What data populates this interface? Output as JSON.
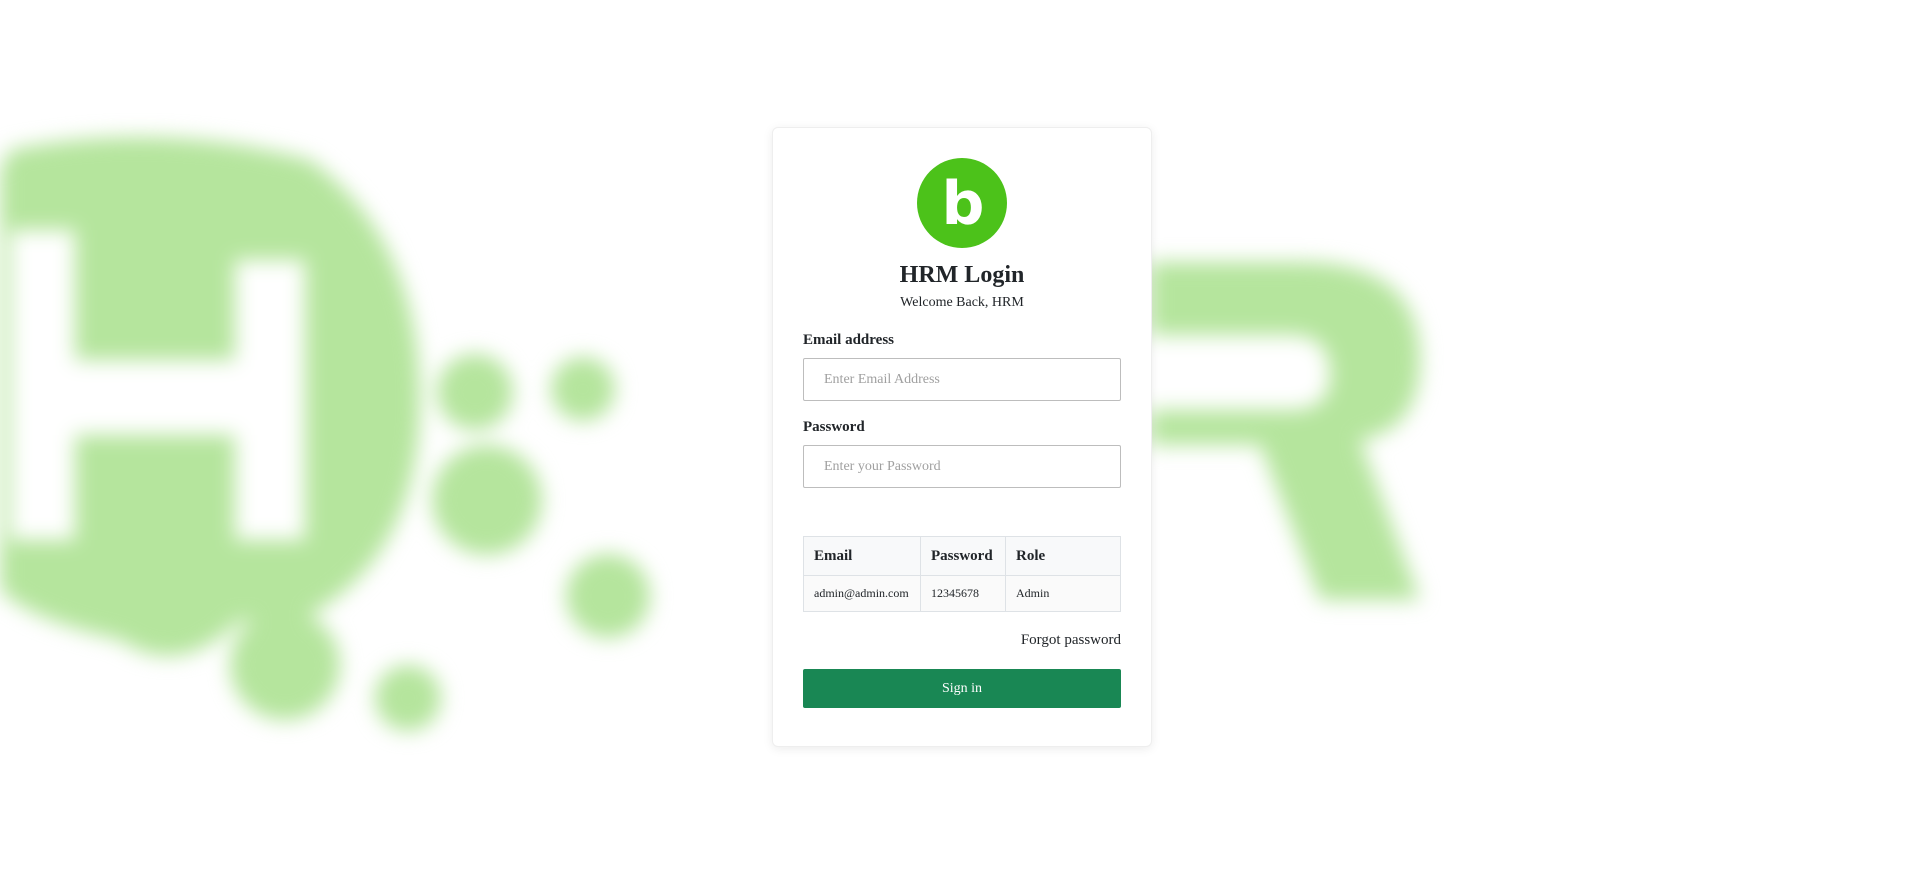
{
  "background": {
    "art": "blurred-hrm-logo-background",
    "accent_color": "#b5e59d"
  },
  "logo": {
    "icon": "letter-b-logo-icon",
    "letter": "b",
    "color": "#4cc21a"
  },
  "login": {
    "title": "HRM Login",
    "subtitle": "Welcome Back, HRM",
    "email_label": "Email address",
    "email_placeholder": "Enter Email Address",
    "email_value": "",
    "password_label": "Password",
    "password_placeholder": "Enter your Password",
    "password_value": "",
    "forgot_label": "Forgot password",
    "signin_label": "Sign in",
    "signin_color": "#198754"
  },
  "credentials_table": {
    "headers": [
      "Email",
      "Password",
      "Role"
    ],
    "rows": [
      [
        "admin@admin.com",
        "12345678",
        "Admin"
      ]
    ]
  }
}
